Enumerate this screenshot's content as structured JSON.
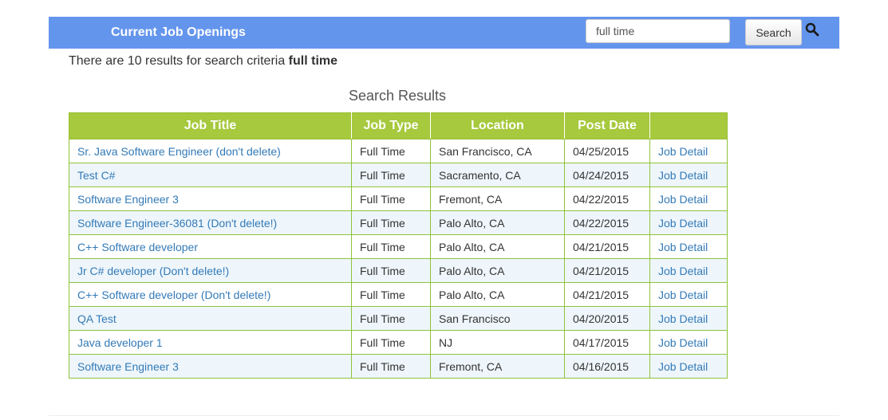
{
  "header": {
    "title": "Current Job Openings",
    "search_value": "full time",
    "search_button_label": "Search",
    "background_color": "#6495ed"
  },
  "summary": {
    "prefix": "There are 10 results for search criteria",
    "criteria": "full time"
  },
  "results": {
    "heading": "Search Results",
    "header_color": "#a6c93d",
    "columns": [
      "Job Title",
      "Job Type",
      "Location",
      "Post Date",
      ""
    ],
    "rows": [
      {
        "title": "Sr. Java Software Engineer (don't delete)",
        "type": "Full Time",
        "location": "San Francisco, CA",
        "date": "04/25/2015",
        "detail": "Job Detail"
      },
      {
        "title": "Test C#",
        "type": "Full Time",
        "location": "Sacramento, CA",
        "date": "04/24/2015",
        "detail": "Job Detail"
      },
      {
        "title": "Software Engineer 3",
        "type": "Full Time",
        "location": "Fremont, CA",
        "date": "04/22/2015",
        "detail": "Job Detail"
      },
      {
        "title": "Software Engineer-36081 (Don't delete!)",
        "type": "Full Time",
        "location": "Palo Alto, CA",
        "date": "04/22/2015",
        "detail": "Job Detail"
      },
      {
        "title": "C++ Software developer",
        "type": "Full Time",
        "location": "Palo Alto, CA",
        "date": "04/21/2015",
        "detail": "Job Detail"
      },
      {
        "title": "Jr C# developer (Don't delete!)",
        "type": "Full Time",
        "location": "Palo Alto, CA",
        "date": "04/21/2015",
        "detail": "Job Detail"
      },
      {
        "title": "C++ Software developer (Don't delete!)",
        "type": "Full Time",
        "location": "Palo Alto, CA",
        "date": "04/21/2015",
        "detail": "Job Detail"
      },
      {
        "title": "QA Test",
        "type": "Full Time",
        "location": "San Francisco",
        "date": "04/20/2015",
        "detail": "Job Detail"
      },
      {
        "title": "Java developer 1",
        "type": "Full Time",
        "location": "NJ",
        "date": "04/17/2015",
        "detail": "Job Detail"
      },
      {
        "title": "Software Engineer 3",
        "type": "Full Time",
        "location": "Fremont, CA",
        "date": "04/16/2015",
        "detail": "Job Detail"
      }
    ]
  }
}
